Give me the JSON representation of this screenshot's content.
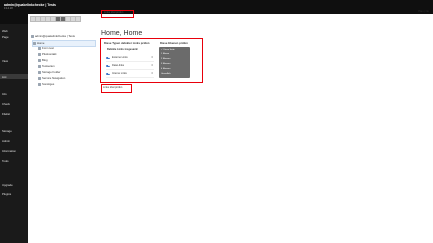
{
  "header": {
    "site_name": "admin@quakelinkchecke | Tests",
    "version": "13.4.18"
  },
  "sidebar": {
    "items": [
      {
        "label": "Web"
      },
      {
        "label": "Page"
      },
      {
        "label": "View"
      },
      {
        "label": "List"
      },
      {
        "label": "Info"
      },
      {
        "label": "Check"
      },
      {
        "label": "Filelist"
      },
      {
        "label": "Storage"
      },
      {
        "label": "Admin"
      },
      {
        "label": "Information"
      },
      {
        "label": "Tools"
      },
      {
        "label": "Upgrade"
      },
      {
        "label": "Plugins"
      }
    ]
  },
  "tree": {
    "root": "admin@quakelinkchecke | Tests",
    "nodes": [
      {
        "label": "Home"
      },
      {
        "label": "Form test"
      },
      {
        "label": "Pluskontakt"
      },
      {
        "label": "Blog"
      },
      {
        "label": "Testseiten"
      },
      {
        "label": "Storage Folder"
      },
      {
        "label": "Service Navigation"
      },
      {
        "label": "Sonstiges"
      }
    ]
  },
  "topnav": {
    "language": "Links überprüfen",
    "view_right": "Plan | Ne"
  },
  "main": {
    "title": "Home, Home",
    "panel_left_title": "Diese Typen defekter Links prüfen",
    "panel_left_sub": "Defekte Links insgesamt:",
    "link_types": [
      {
        "label": "Externe Links",
        "count": "0"
      },
      {
        "label": "Datei-links",
        "count": "0"
      },
      {
        "label": "Interne Links",
        "count": "0"
      }
    ],
    "panel_right_title": "Diese Ebenen prüfen",
    "depth_options": [
      {
        "label": "Diese Seite",
        "selected": true
      },
      {
        "label": "1 Ebene",
        "selected": false
      },
      {
        "label": "2 Ebenen",
        "selected": false
      },
      {
        "label": "3 Ebenen",
        "selected": false
      },
      {
        "label": "4 Ebenen",
        "selected": false
      },
      {
        "label": "Unendlich",
        "selected": false
      }
    ],
    "check_button": "Links überprüfen"
  },
  "colors": {
    "highlight": "#e8000b",
    "toggle": "#3d76c9",
    "dark_bg": "#0f0f0f"
  }
}
